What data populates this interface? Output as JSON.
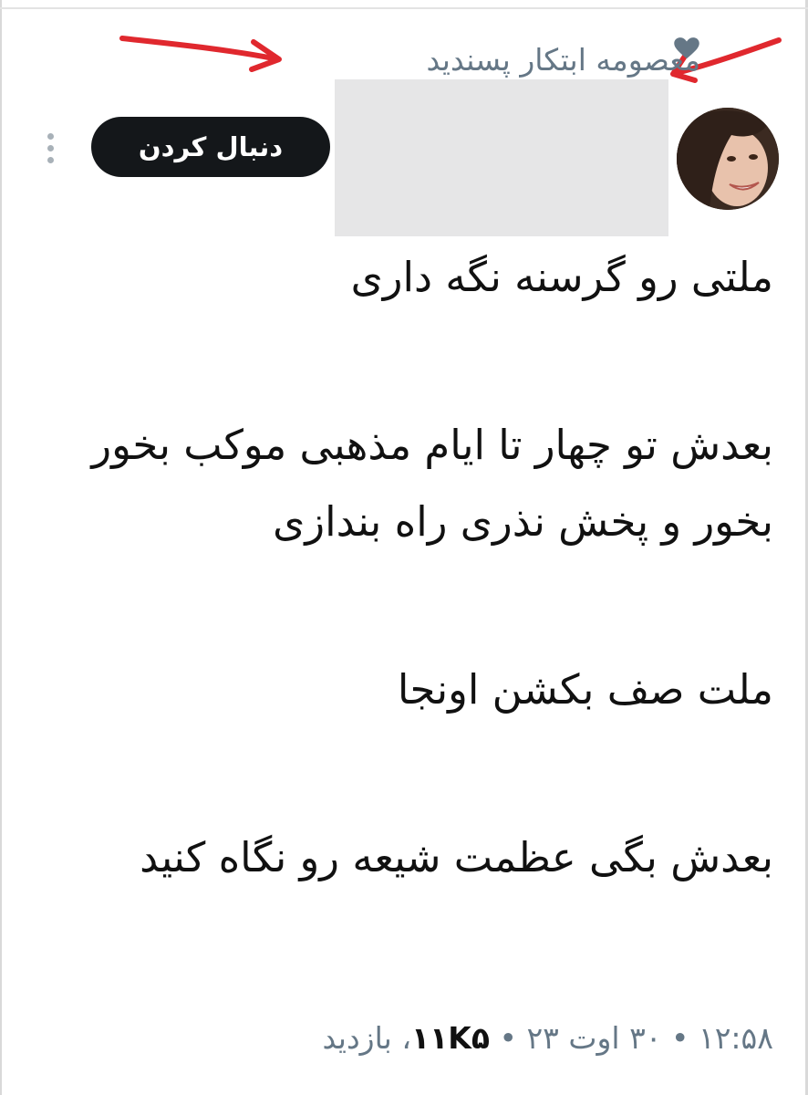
{
  "liked_by": {
    "text": "معصومه ابتکار پسندید",
    "icon": "heart-icon"
  },
  "author": {
    "avatar": "user-avatar",
    "follow_label": "دنبال کردن",
    "more_icon": "more-vertical-icon"
  },
  "tweet": {
    "paragraphs": [
      "ملتی رو گرسنه نگه داری",
      "بعدش تو چهار تا ایام مذهبی موکب بخور بخور و پخش نذری راه بندازی",
      "ملت صف بکشن اونجا",
      "بعدش بگی عظمت شیعه رو نگاه کنید"
    ]
  },
  "meta": {
    "timestamp": "۱۲:۵۸ • ۳۰ اوت ۲۳ •",
    "views_count": "۱۱K۵",
    "views_label": "، بازدید"
  },
  "colors": {
    "follow_button_bg": "#14171a",
    "muted_text": "#657786",
    "annotation_arrow": "#e0282e"
  }
}
